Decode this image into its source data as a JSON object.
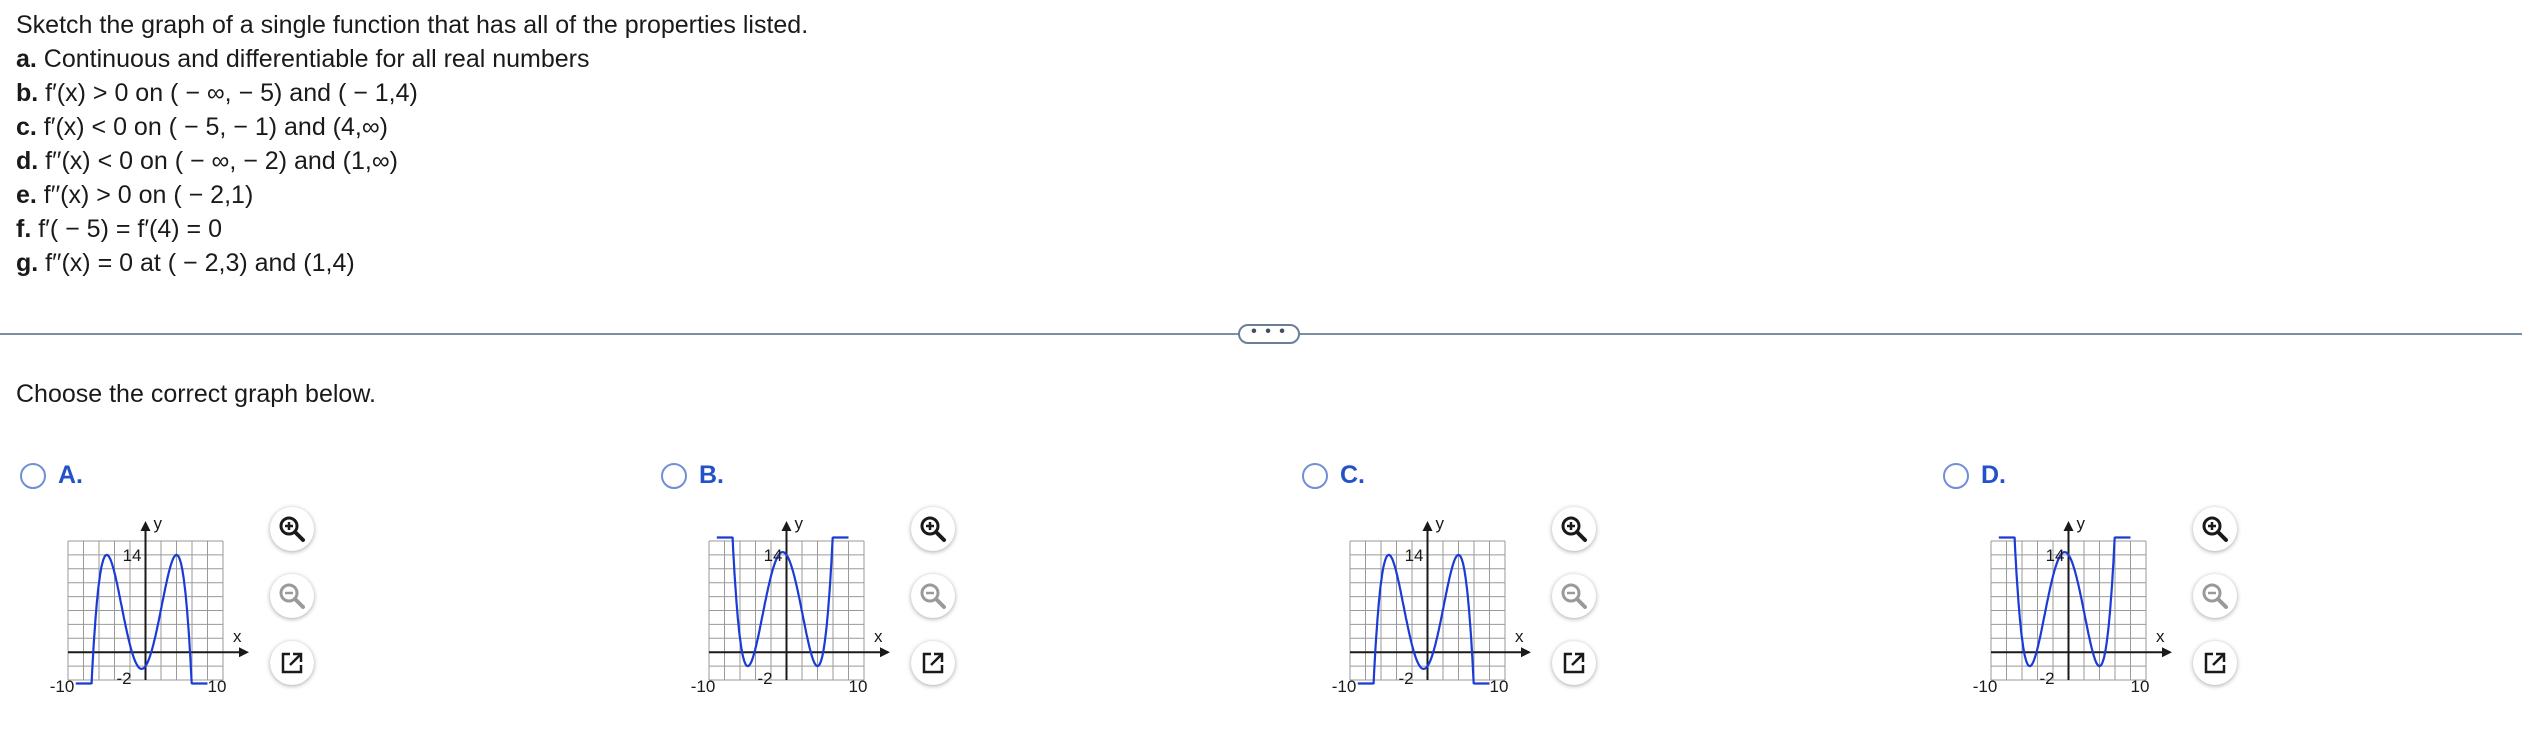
{
  "question": {
    "intro": "Sketch the graph of a single function that has all of the properties listed.",
    "properties": [
      {
        "letter": "a.",
        "text": " Continuous and differentiable for all real numbers"
      },
      {
        "letter": "b.",
        "text": " f′(x) > 0 on ( − ∞, − 5) and ( − 1,4)"
      },
      {
        "letter": "c.",
        "text": " f′(x) < 0 on ( − 5, − 1) and (4,∞)"
      },
      {
        "letter": "d.",
        "text": " f′′(x) < 0 on ( − ∞, − 2) and (1,∞)"
      },
      {
        "letter": "e.",
        "text": " f′′(x) > 0 on ( − 2,1)"
      },
      {
        "letter": "f.",
        "text": " f′( − 5) = f′(4) = 0"
      },
      {
        "letter": "g.",
        "text": " f′′(x) = 0 at ( − 2,3) and (1,4)"
      }
    ]
  },
  "divider": {
    "button_label": "• • •"
  },
  "prompt": "Choose the correct graph below.",
  "choices": [
    {
      "letter": "A.",
      "selected": false,
      "shape": "max-min-max"
    },
    {
      "letter": "B.",
      "selected": false,
      "shape": "min-max-min"
    },
    {
      "letter": "C.",
      "selected": false,
      "shape": "max-min-max"
    },
    {
      "letter": "D.",
      "selected": false,
      "shape": "min-max-min"
    }
  ],
  "graph_labels": {
    "y_axis": "y",
    "x_axis": "x",
    "y_tick": "14",
    "x_min": "-10",
    "x_mid": "-2",
    "x_max": "10"
  },
  "tools": {
    "zoom_in": "zoom-in-icon",
    "zoom_out": "zoom-out-icon",
    "open": "open-new-window-icon"
  },
  "colors": {
    "curve": "#1a3bd6",
    "grid": "#9a9a9a",
    "choice_label": "#2451c7",
    "radio_border": "#6f8fd6"
  }
}
